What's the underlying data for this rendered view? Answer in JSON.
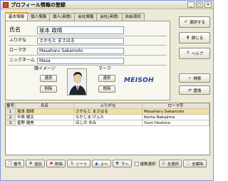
{
  "window": {
    "title": "プロフィール情報の登録",
    "minimize": "_",
    "maximize": "□",
    "close": "×"
  },
  "tabs": [
    {
      "label": "基本情報",
      "active": true
    },
    {
      "label": "個人情報",
      "active": false
    },
    {
      "label": "個人(英語)",
      "active": false
    },
    {
      "label": "会社情報",
      "active": false
    },
    {
      "label": "会社(英語)",
      "active": false
    },
    {
      "label": "自由項目",
      "active": false
    }
  ],
  "form": {
    "name_label": "氏名",
    "name_value": "坂本 政晴",
    "kana_label": "ふりがな",
    "kana_value": "さかもと まさはる",
    "roman_label": "ローマ字",
    "roman_value": "Masaharu Sakamoto",
    "nick_label": "ニックネーム",
    "nick_value": "Masa",
    "face_label": "顔イメージ",
    "face_select": "選択",
    "face_delete": "削除",
    "mark_label": "マーク",
    "mark_select": "選択",
    "mark_delete": "削除",
    "mark_logo_text": "MEISOH"
  },
  "side_buttons": {
    "select": "選択する",
    "close": "閉じる",
    "help": "ヘルプ",
    "search": "検索",
    "replace": "置換"
  },
  "grid": {
    "headers": [
      "番号",
      "氏名",
      "ふりがな",
      "ローマ字"
    ],
    "rows": [
      {
        "no": "1",
        "name": "坂本 政晴",
        "kana": "さかもと まさはる",
        "roman": "Masaharu Sakamoto",
        "selected": true
      },
      {
        "no": "2",
        "name": "中島 健太",
        "kana": "なかじま けんた",
        "roman": "Kenta Nakajima",
        "selected": false
      },
      {
        "no": "3",
        "name": "星野 優美",
        "kana": "ほしの ゆみ",
        "roman": "Yumi Hoshino",
        "selected": false
      }
    ]
  },
  "bottom_bar": {
    "copy": "複写",
    "add": "追加",
    "delete": "削除",
    "sort": "ソート",
    "up": "上へ",
    "down": "下へ",
    "multi_select": "複数選択",
    "select_all": "全選択",
    "clear_all": "全解除"
  },
  "colors": {
    "selected_row": "#f2e0a0",
    "accent_tab": "#e0a030",
    "logo": "#1f3f9a"
  }
}
